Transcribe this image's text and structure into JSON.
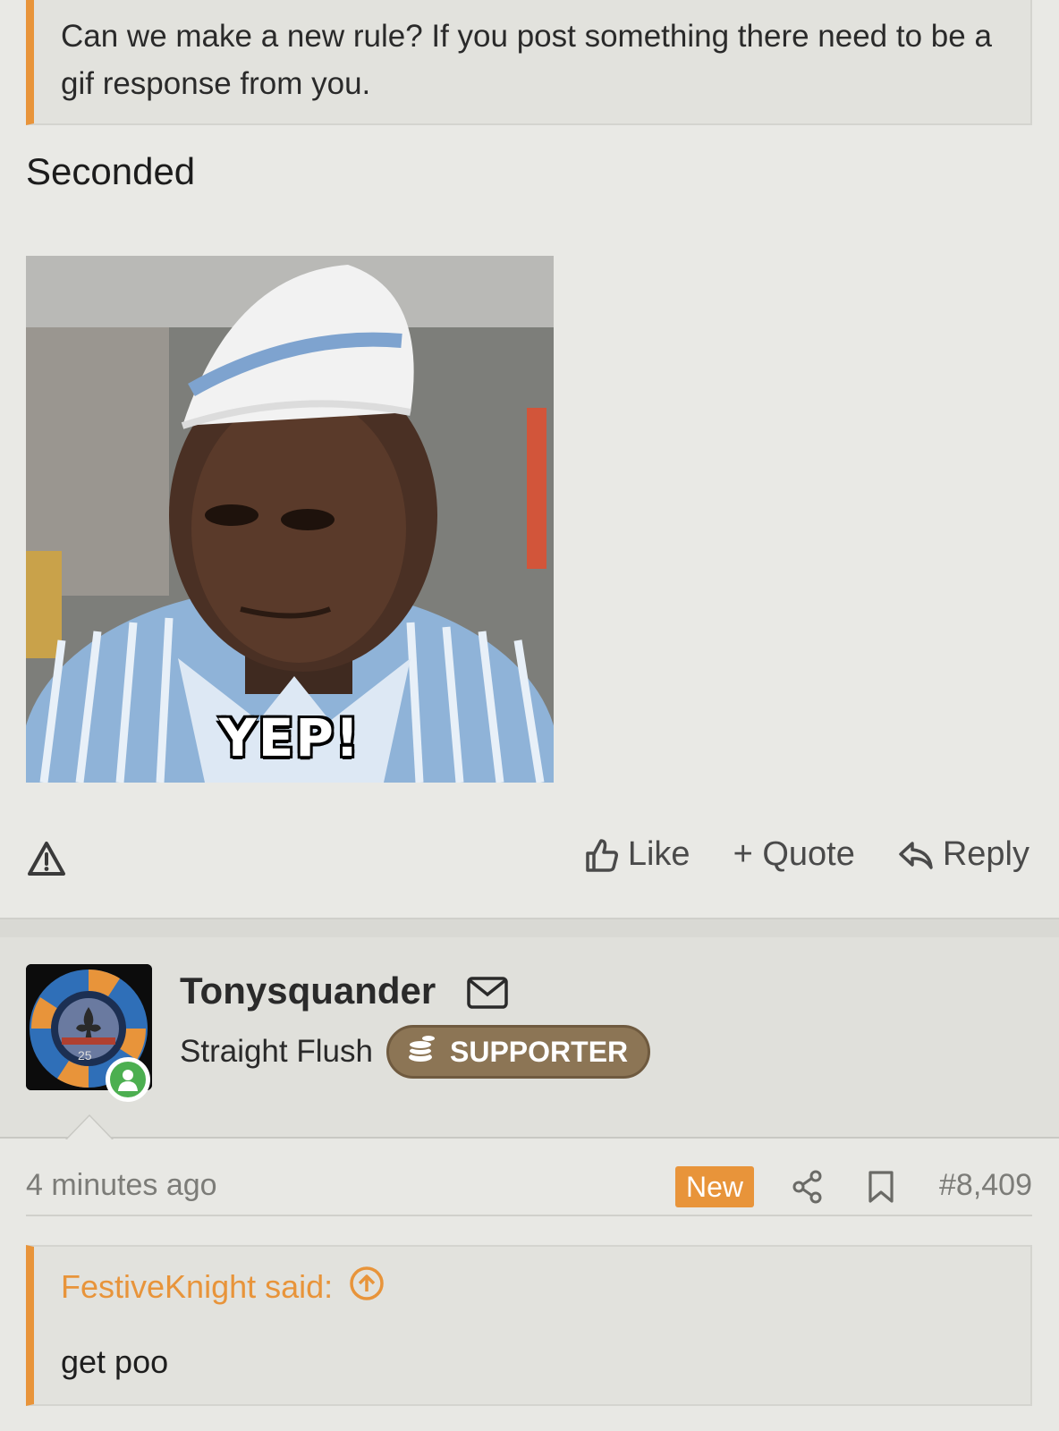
{
  "quoted_post": {
    "text": "Can we make a new rule? If you post something there need to be a gif response from you."
  },
  "post": {
    "text": "Seconded",
    "gif_caption": "YEP!"
  },
  "post_actions": {
    "report_icon": "warning-icon",
    "like_label": "Like",
    "quote_label": "+ Quote",
    "reply_label": "Reply"
  },
  "next_post": {
    "username": "Tonysquander",
    "user_title": "Straight Flush",
    "badge_label": "SUPPORTER",
    "avatar_chip_text": "25",
    "timestamp": "4 minutes ago",
    "new_label": "New",
    "post_number": "#8,409",
    "quote": {
      "attribution": "FestiveKnight said:",
      "text": "get poo"
    }
  },
  "colors": {
    "accent_orange": "#e8943a",
    "badge_brown": "#8c7555",
    "online_green": "#4caf50",
    "background": "#e8e8e4"
  }
}
